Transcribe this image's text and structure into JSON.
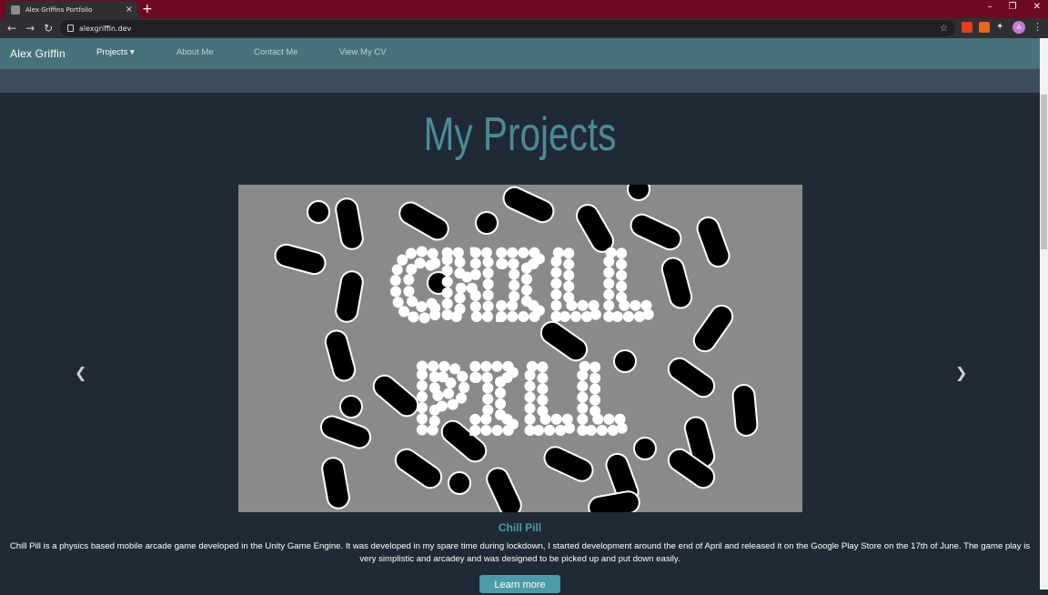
{
  "browser": {
    "tab_title": "Alex Griffins Portfolio",
    "url": "alexgriffin.dev",
    "avatar_letter": "A"
  },
  "navbar": {
    "brand": "Alex Griffin",
    "items": [
      {
        "label": "Projects ▾"
      },
      {
        "label": "About Me"
      },
      {
        "label": "Contact Me"
      },
      {
        "label": "View My CV"
      }
    ]
  },
  "page": {
    "heading": "My Projects",
    "slide": {
      "image_text_line1": "CHILL",
      "image_text_line2": "PILL",
      "title": "Chill Pill",
      "description": "Chill Pill is a physics based mobile arcade game developed in the Unity Game Engine. It was developed in my spare time during lockdown, I started development around the end of April and released it on the Google Play Store on the 17th of June. The game play is very simplistic and arcadey and was designed to be picked up and put down easily.",
      "button": "Learn more"
    }
  },
  "colors": {
    "accent": "#4d9aa8",
    "navbar": "#47727a",
    "background": "#1f2a36"
  }
}
